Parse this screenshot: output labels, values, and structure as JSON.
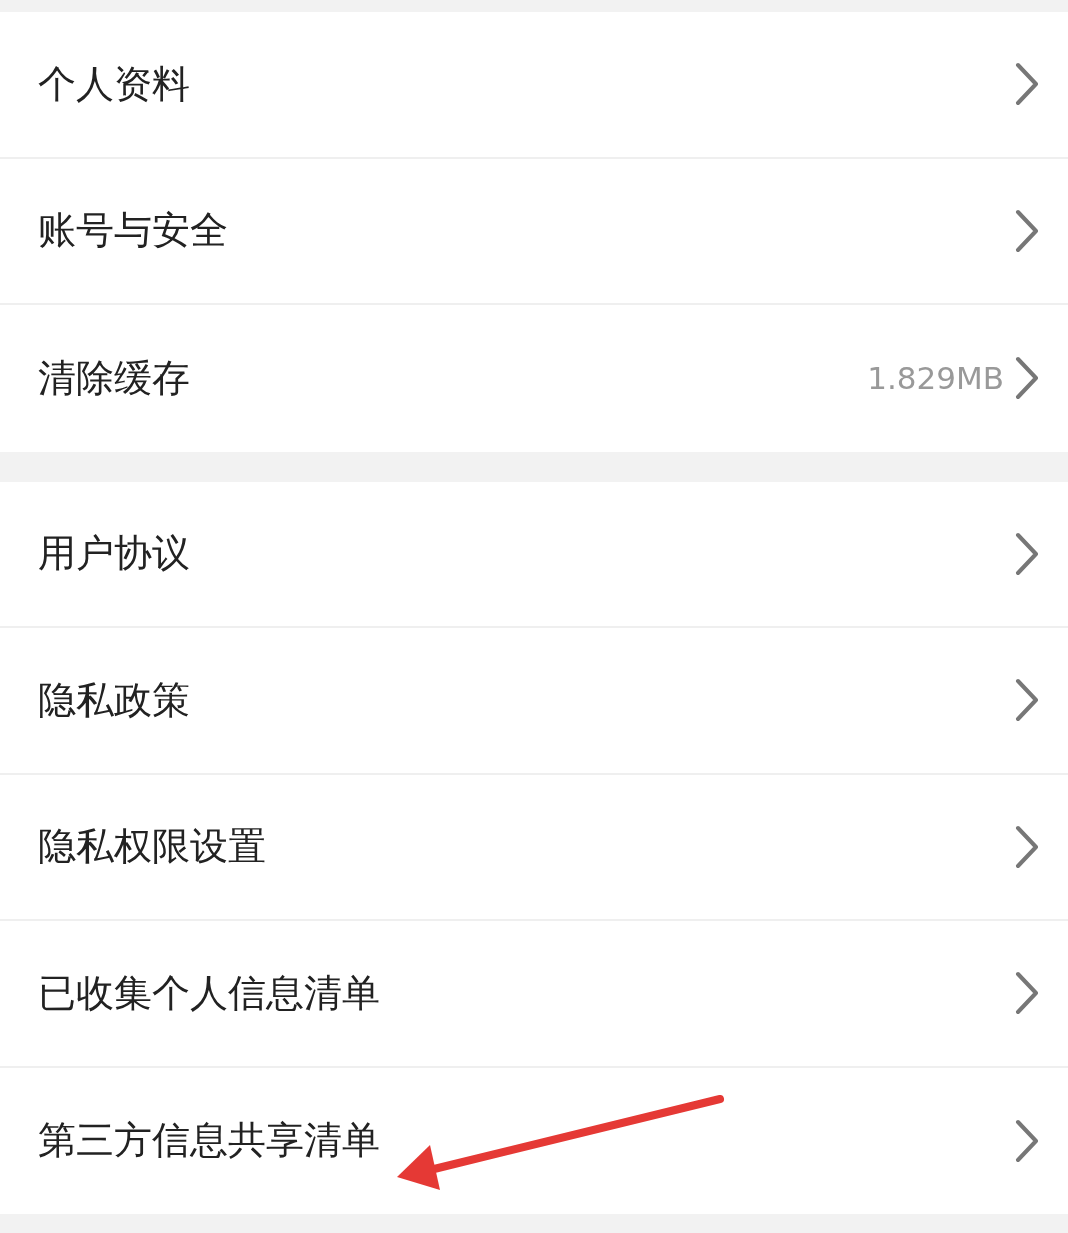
{
  "groups": [
    {
      "items": [
        {
          "label": "个人资料"
        },
        {
          "label": "账号与安全"
        },
        {
          "label": "清除缓存",
          "value": "1.829MB"
        }
      ]
    },
    {
      "items": [
        {
          "label": "用户协议"
        },
        {
          "label": "隐私政策"
        },
        {
          "label": "隐私权限设置"
        },
        {
          "label": "已收集个人信息清单"
        },
        {
          "label": "第三方信息共享清单"
        }
      ]
    }
  ]
}
